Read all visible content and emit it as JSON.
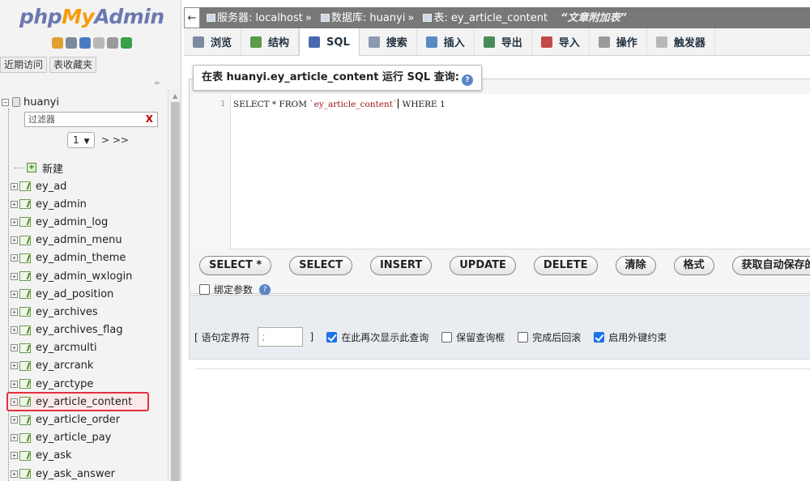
{
  "logo": {
    "part1": "php",
    "part2": "My",
    "part3": "Admin"
  },
  "nav_icons": [
    {
      "name": "home-icon",
      "color": "#e0a030"
    },
    {
      "name": "exit-icon",
      "color": "#7a8a9a"
    },
    {
      "name": "help-icon",
      "color": "#4a7ac4"
    },
    {
      "name": "docs-icon",
      "color": "#b8b8b8"
    },
    {
      "name": "settings-icon",
      "color": "#9a9a9a"
    },
    {
      "name": "reload-icon",
      "color": "#3aa04a"
    }
  ],
  "recent_tabs": [
    "近期访问",
    "表收藏夹"
  ],
  "link_icon": "∞",
  "db": {
    "name": "huanyi",
    "expander": "−"
  },
  "filter": {
    "placeholder": "过滤器",
    "clear": "X"
  },
  "pager": {
    "value": "1",
    "next": "> >>"
  },
  "new_label": "新建",
  "tables": [
    {
      "name": "ey_ad"
    },
    {
      "name": "ey_admin"
    },
    {
      "name": "ey_admin_log"
    },
    {
      "name": "ey_admin_menu"
    },
    {
      "name": "ey_admin_theme"
    },
    {
      "name": "ey_admin_wxlogin"
    },
    {
      "name": "ey_ad_position"
    },
    {
      "name": "ey_archives"
    },
    {
      "name": "ey_archives_flag"
    },
    {
      "name": "ey_arcmulti"
    },
    {
      "name": "ey_arcrank"
    },
    {
      "name": "ey_arctype"
    },
    {
      "name": "ey_article_content",
      "active": true
    },
    {
      "name": "ey_article_order"
    },
    {
      "name": "ey_article_pay"
    },
    {
      "name": "ey_ask"
    },
    {
      "name": "ey_ask_answer"
    }
  ],
  "breadcrumb": {
    "back": "←",
    "server": "服务器: localhost",
    "database": "数据库: huanyi",
    "table": "表: ey_article_content",
    "comment": "“文章附加表”",
    "sep": "»"
  },
  "tabs": [
    {
      "label": "浏览",
      "icon": "browse-icon",
      "color": "#7a8aa0"
    },
    {
      "label": "结构",
      "icon": "structure-icon",
      "color": "#5a9a4a"
    },
    {
      "label": "SQL",
      "icon": "sql-icon",
      "color": "#4a6ab0",
      "active": true
    },
    {
      "label": "搜索",
      "icon": "search-icon",
      "color": "#8a9ab0"
    },
    {
      "label": "插入",
      "icon": "insert-icon",
      "color": "#5a8ac4"
    },
    {
      "label": "导出",
      "icon": "export-icon",
      "color": "#4a8a5a"
    },
    {
      "label": "导入",
      "icon": "import-icon",
      "color": "#c44a4a"
    },
    {
      "label": "操作",
      "icon": "wrench-icon",
      "color": "#9a9a9a"
    },
    {
      "label": "触发器",
      "icon": "triggers-icon",
      "color": "#b8b8b8"
    }
  ],
  "sql": {
    "legend_prefix": "在表 ",
    "legend_table": "huanyi.ey_article_content",
    "legend_suffix": " 运行 SQL 查询:",
    "line_number": "1",
    "code_before": "SELECT * FROM ",
    "code_string": "`ey_article_content`",
    "code_after": " WHERE 1"
  },
  "buttons": [
    "SELECT *",
    "SELECT",
    "INSERT",
    "UPDATE",
    "DELETE",
    "清除",
    "格式",
    "获取自动保存的查询"
  ],
  "bind_params": "绑定参数",
  "options": {
    "delimiter_label": "[ 语句定界符",
    "delimiter_value": ";",
    "delimiter_close": "]",
    "show_again": "在此再次显示此查询",
    "keep_box": "保留查询框",
    "rollback": "完成后回滚",
    "foreign_keys": "启用外键约束"
  }
}
